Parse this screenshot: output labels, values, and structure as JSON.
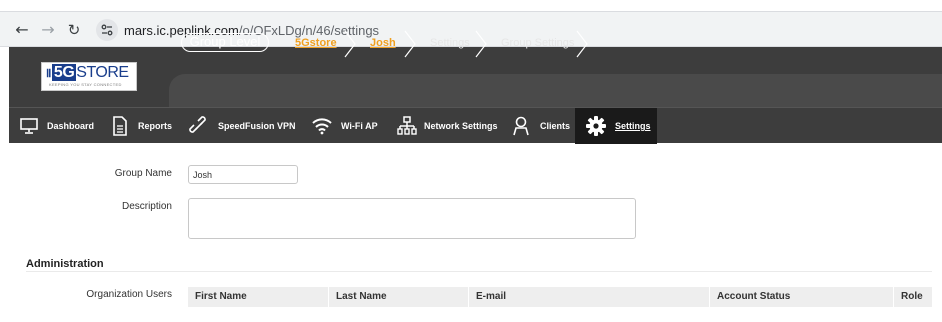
{
  "browser": {
    "url_host": "mars.ic.peplink.com",
    "url_path": "/o/OFxLDg/n/46/settings",
    "back_icon": "arrow-left-icon",
    "forward_icon": "arrow-right-icon",
    "reload_icon": "reload-icon",
    "site_info_icon": "tune-icon"
  },
  "logo": {
    "bars": "Ⅱ",
    "g5": "5G",
    "store": "STORE",
    "tagline": "KEEPING YOU STAY CONNECTED"
  },
  "breadcrumb": {
    "group_level": "Group Level",
    "items": [
      "5Gstore",
      "Josh",
      "Settings",
      "Group Settings"
    ]
  },
  "nav": {
    "items": [
      {
        "label": "Dashboard",
        "icon": "monitor-icon"
      },
      {
        "label": "Reports",
        "icon": "document-icon"
      },
      {
        "label": "SpeedFusion VPN",
        "icon": "link-icon"
      },
      {
        "label": "Wi-Fi AP",
        "icon": "wifi-icon"
      },
      {
        "label": "Network Settings",
        "icon": "network-icon"
      },
      {
        "label": "Clients",
        "icon": "user-icon"
      },
      {
        "label": "Settings",
        "icon": "gear-icon"
      }
    ],
    "active": "Settings"
  },
  "form": {
    "group_name_label": "Group Name",
    "group_name_value": "Josh",
    "description_label": "Description",
    "description_value": ""
  },
  "administration": {
    "title": "Administration",
    "org_users_label": "Organization Users",
    "columns": [
      "First Name",
      "Last Name",
      "E-mail",
      "Account Status",
      "Role"
    ]
  },
  "colors": {
    "header_bg": "#3d3d3d",
    "accent_orange": "#f0a020",
    "active_tab_bg": "#1a1a1a"
  }
}
